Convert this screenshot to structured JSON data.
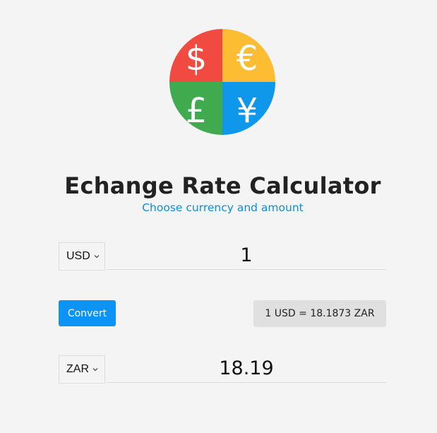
{
  "logo": {
    "symbols": [
      "$",
      "€",
      "£",
      "¥"
    ],
    "colors": {
      "top_left": "#f04a41",
      "top_right": "#fdbd32",
      "bottom_left": "#3fab4e",
      "bottom_right": "#0f97ec"
    }
  },
  "header": {
    "title": "Echange Rate Calculator",
    "subtitle": "Choose currency and amount"
  },
  "from": {
    "currency": "USD",
    "amount": "1"
  },
  "actions": {
    "convert_label": "Convert"
  },
  "rate": {
    "text": "1 USD = 18.1873 ZAR"
  },
  "to": {
    "currency": "ZAR",
    "amount": "18.19"
  },
  "theme": {
    "accent": "#0b93f5",
    "subtitle_color": "#0a8fdf",
    "background": "#f4f4f4"
  }
}
